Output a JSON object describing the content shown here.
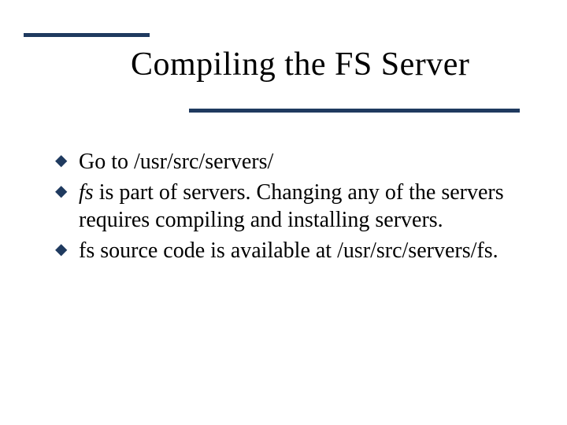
{
  "title": "Compiling the FS Server",
  "bullets": {
    "b1": "Go to /usr/src/servers/",
    "b2_fs": "fs",
    "b2_rest": " is part of servers. Changing any of the servers requires compiling and installing servers.",
    "b3": "fs source code is available at /usr/src/servers/fs."
  },
  "glyph": "◆"
}
